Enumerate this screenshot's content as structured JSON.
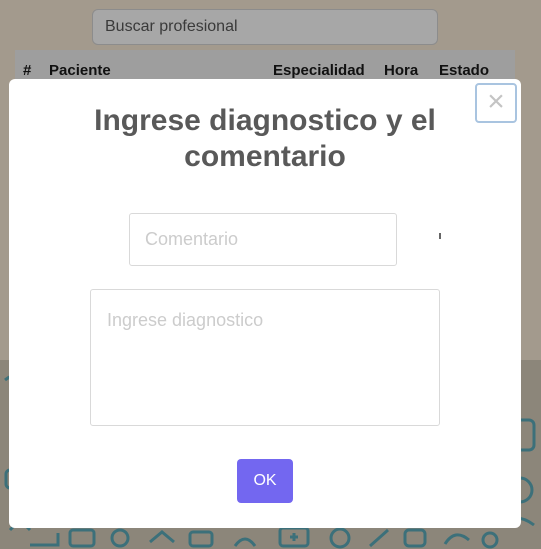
{
  "search": {
    "placeholder": "Buscar profesional"
  },
  "table": {
    "columns": [
      "#",
      "Paciente",
      "Especialidad",
      "Hora",
      "Estado"
    ]
  },
  "modal": {
    "title": "Ingrese diagnostico y el comentario",
    "close_icon": "×",
    "comment_placeholder": "Comentario",
    "diagnosis_placeholder": "Ingrese diagnostico",
    "ok_label": "OK"
  },
  "colors": {
    "confirm_button": "#7367f0",
    "backdrop": "#a39a8d",
    "pattern": "#2d8a9e"
  },
  "icons": {
    "close": "close-icon",
    "background": "medical-pattern"
  }
}
